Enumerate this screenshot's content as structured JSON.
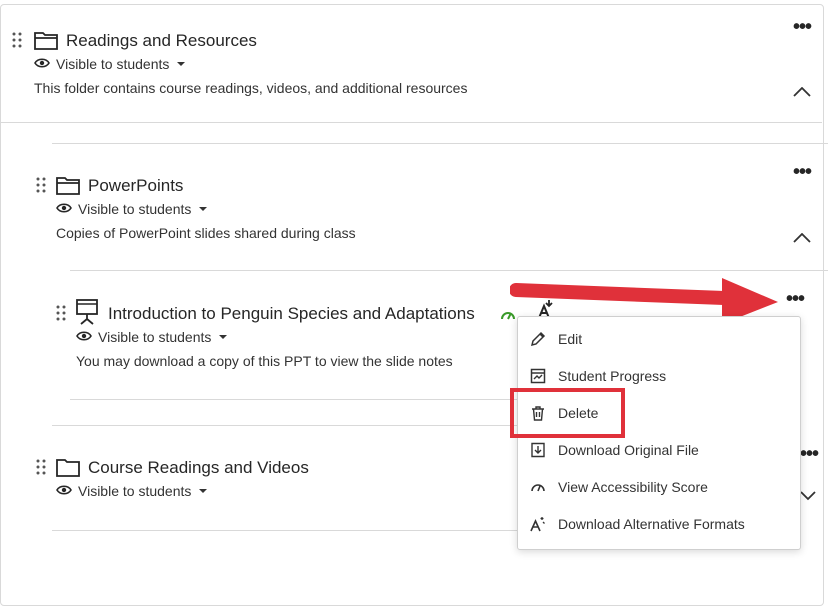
{
  "folders": {
    "readings": {
      "title": "Readings and Resources",
      "visibility": "Visible to students",
      "description": "This folder contains course readings, videos, and additional resources"
    },
    "powerpoints": {
      "title": "PowerPoints",
      "visibility": "Visible to students",
      "description": "Copies of PowerPoint slides shared during class"
    },
    "course_readings": {
      "title": "Course Readings and Videos",
      "visibility": "Visible to students"
    }
  },
  "item": {
    "title": "Introduction to Penguin Species and Adaptations",
    "visibility": "Visible to students",
    "description": "You may download a copy of this PPT to view the slide notes"
  },
  "menu": {
    "items": [
      {
        "label": "Edit",
        "icon": "pencil-icon"
      },
      {
        "label": "Student Progress",
        "icon": "progress-icon"
      },
      {
        "label": "Delete",
        "icon": "trash-icon"
      },
      {
        "label": "Download Original File",
        "icon": "download-file-icon"
      },
      {
        "label": "View Accessibility Score",
        "icon": "gauge-icon"
      },
      {
        "label": "Download Alternative Formats",
        "icon": "alt-formats-icon"
      }
    ]
  },
  "colors": {
    "annotation_red": "#e0313a",
    "accessibility_green": "#3a9a2a"
  }
}
